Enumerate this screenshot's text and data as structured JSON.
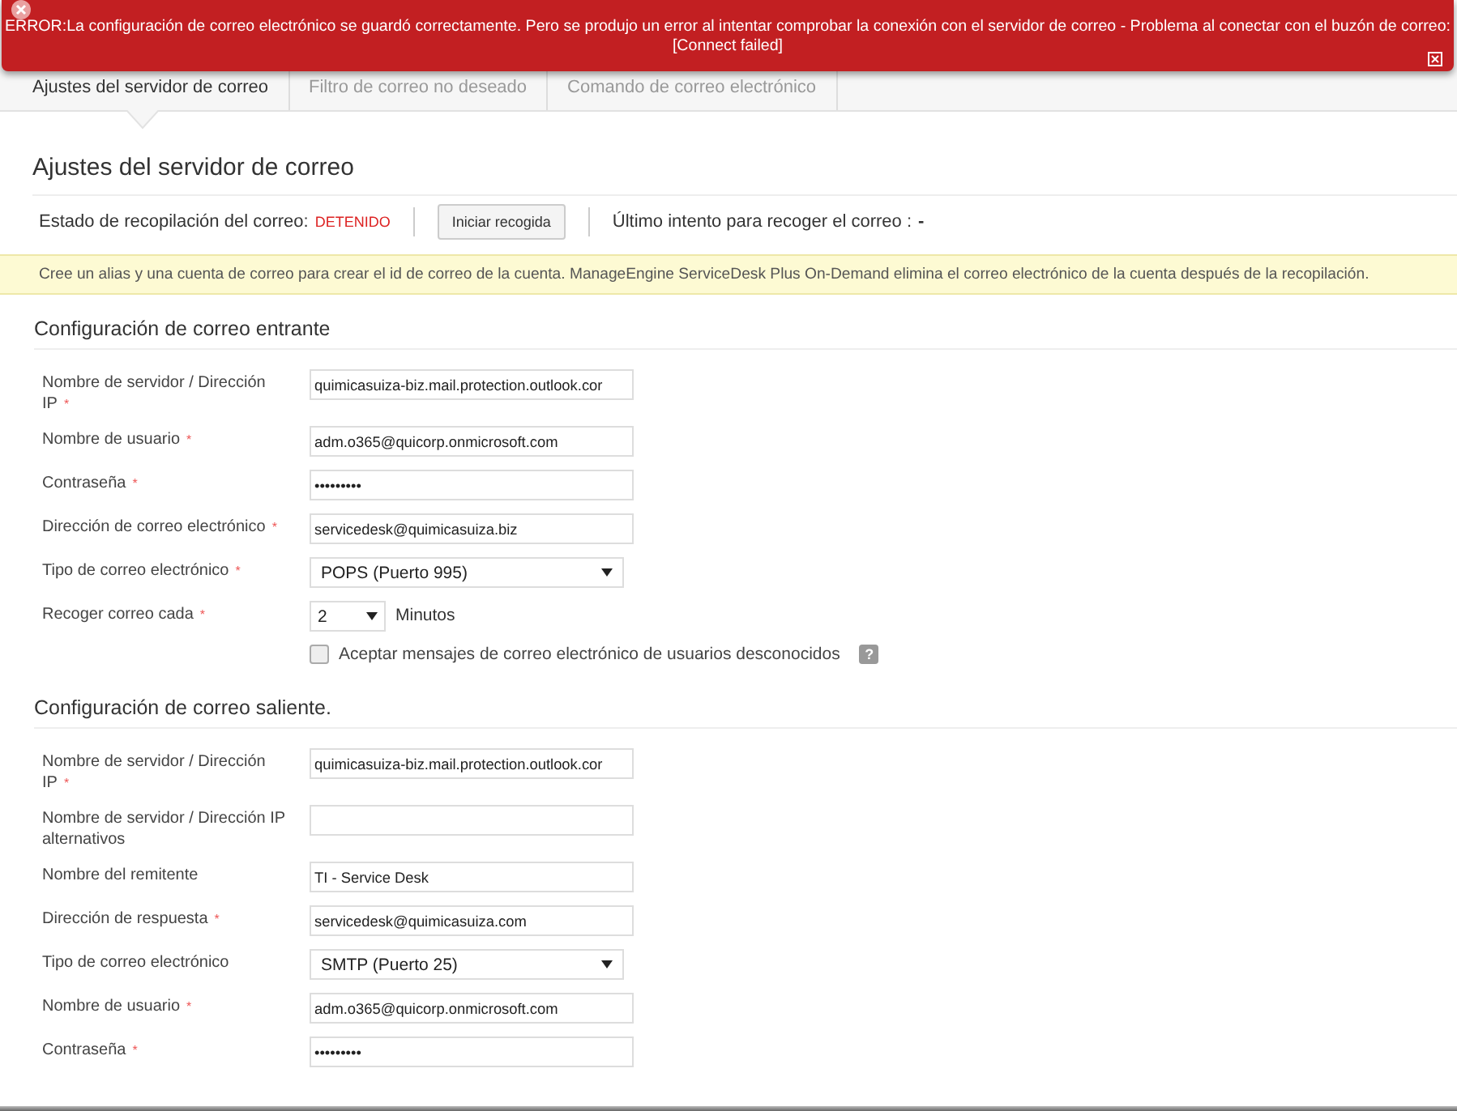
{
  "error_banner": {
    "message": "ERROR:La configuración de correo electrónico se guardó correctamente. Pero se produjo un error al intentar comprobar la conexión con el servidor de correo - Problema al conectar con el buzón de correo:",
    "detail": "[Connect failed]"
  },
  "tabs": [
    {
      "label": "Ajustes del servidor de correo",
      "selected": true
    },
    {
      "label": "Filtro de correo no deseado",
      "selected": false
    },
    {
      "label": "Comando de correo electrónico",
      "selected": false
    }
  ],
  "page_title": "Ajustes del servidor de correo",
  "status": {
    "label": "Estado de recopilación del correo:",
    "value": "DETENIDO",
    "button": "Iniciar recogida",
    "last_attempt_label": "Último intento para recoger el correo :",
    "last_attempt_value": "-"
  },
  "notice": "Cree un alias y una cuenta de correo para crear el id de correo de la cuenta. ManageEngine ServiceDesk Plus On-Demand elimina el correo electrónico de la cuenta después de la recopilación.",
  "sections": [
    {
      "title": "Configuración de correo entrante",
      "fields": [
        {
          "kind": "text",
          "label": "Nombre de servidor / Dirección IP",
          "required_mark": "*",
          "value": "quimicasuiza-biz.mail.protection.outlook.cor"
        },
        {
          "kind": "text",
          "label": "Nombre de usuario",
          "required_mark": "*",
          "value": "adm.o365@quicorp.onmicrosoft.com"
        },
        {
          "kind": "text",
          "label": "Contraseña",
          "required_mark": "*",
          "value": "•••••••••"
        },
        {
          "kind": "text",
          "label": "Dirección de correo electrónico",
          "required_mark": "*",
          "value": "servicedesk@quimicasuiza.biz"
        },
        {
          "kind": "select",
          "label": "Tipo de correo electrónico",
          "required_mark": "*",
          "value": "POPS (Puerto 995)"
        },
        {
          "kind": "interval",
          "label": "Recoger correo cada",
          "required_mark": "*",
          "value": "2",
          "suffix": "Minutos"
        },
        {
          "kind": "checkbox",
          "label": "Aceptar mensajes de correo electrónico de usuarios desconocidos",
          "checked": false,
          "help": "?"
        }
      ]
    },
    {
      "title": "Configuración de correo saliente.",
      "fields": [
        {
          "kind": "text",
          "label": "Nombre de servidor / Dirección IP",
          "required_mark": "*",
          "value": "quimicasuiza-biz.mail.protection.outlook.cor"
        },
        {
          "kind": "text",
          "label": "Nombre de servidor / Dirección IP alternativos"
        },
        {
          "kind": "text",
          "label": "Nombre del remitente",
          "value": "TI - Service Desk"
        },
        {
          "kind": "text",
          "label": "Dirección de respuesta",
          "required_mark": "*",
          "value": "servicedesk@quimicasuiza.com"
        },
        {
          "kind": "select",
          "label": "Tipo de correo electrónico",
          "value": "SMTP (Puerto 25)"
        },
        {
          "kind": "text",
          "label": "Nombre de usuario",
          "required_mark": "*",
          "value": "adm.o365@quicorp.onmicrosoft.com"
        },
        {
          "kind": "text",
          "label": "Contraseña",
          "required_mark": "*",
          "value": "•••••••••"
        }
      ]
    }
  ]
}
